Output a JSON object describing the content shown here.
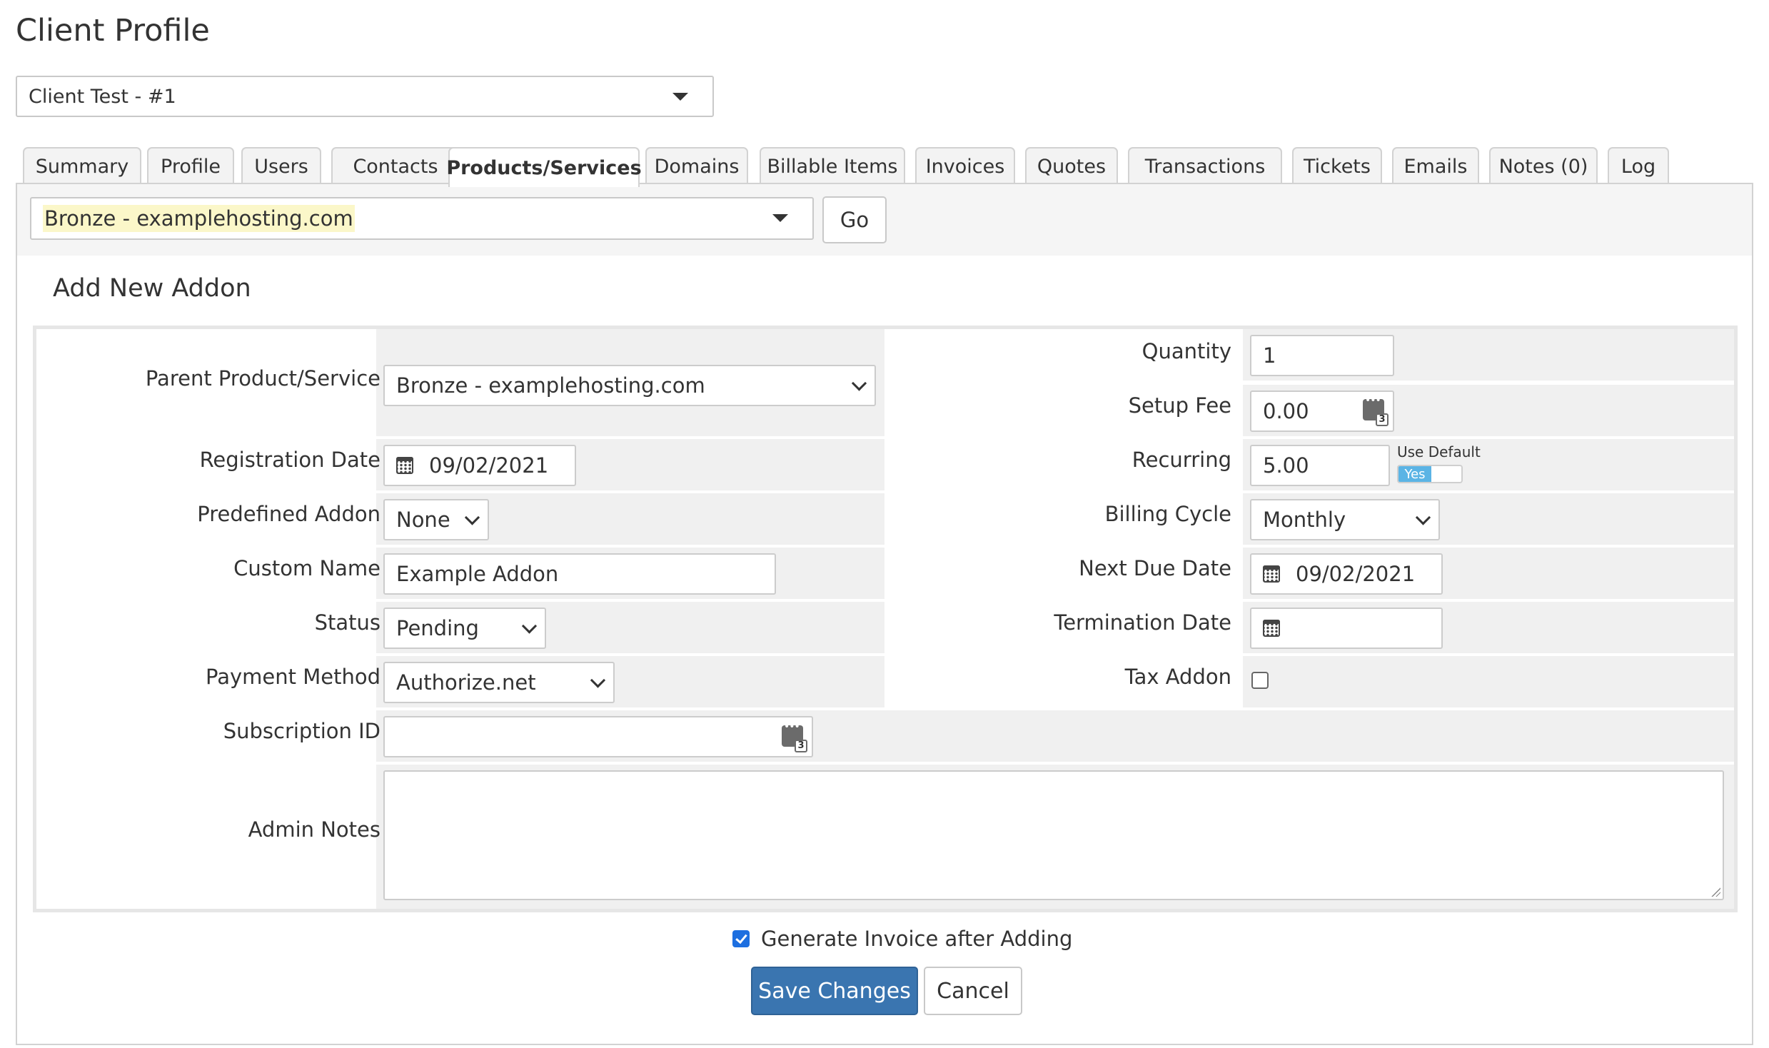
{
  "page": {
    "title": "Client Profile"
  },
  "client_selector": {
    "value": "Client Test - #1"
  },
  "tabs": [
    {
      "label": "Summary",
      "active": false
    },
    {
      "label": "Profile",
      "active": false
    },
    {
      "label": "Users",
      "active": false
    },
    {
      "label": "Contacts",
      "active": false
    },
    {
      "label": "Products/Services",
      "active": true
    },
    {
      "label": "Domains",
      "active": false
    },
    {
      "label": "Billable Items",
      "active": false
    },
    {
      "label": "Invoices",
      "active": false
    },
    {
      "label": "Quotes",
      "active": false
    },
    {
      "label": "Transactions",
      "active": false
    },
    {
      "label": "Tickets",
      "active": false
    },
    {
      "label": "Emails",
      "active": false
    },
    {
      "label": "Notes (0)",
      "active": false
    },
    {
      "label": "Log",
      "active": false
    }
  ],
  "product_bar": {
    "selected": "Bronze - examplehosting.com",
    "go_label": "Go"
  },
  "section_title": "Add New Addon",
  "form": {
    "parent_product": {
      "label": "Parent Product/Service",
      "value": "Bronze - examplehosting.com"
    },
    "registration_date": {
      "label": "Registration Date",
      "value": "09/02/2021"
    },
    "predefined_addon": {
      "label": "Predefined Addon",
      "value": "None"
    },
    "custom_name": {
      "label": "Custom Name",
      "value": "Example Addon"
    },
    "status": {
      "label": "Status",
      "value": "Pending"
    },
    "payment_method": {
      "label": "Payment Method",
      "value": "Authorize.net"
    },
    "subscription_id": {
      "label": "Subscription ID",
      "value": ""
    },
    "admin_notes": {
      "label": "Admin Notes",
      "value": ""
    },
    "quantity": {
      "label": "Quantity",
      "value": "1"
    },
    "setup_fee": {
      "label": "Setup Fee",
      "value": "0.00"
    },
    "recurring": {
      "label": "Recurring",
      "value": "5.00",
      "use_default_label": "Use Default",
      "toggle_label": "Yes"
    },
    "billing_cycle": {
      "label": "Billing Cycle",
      "value": "Monthly"
    },
    "next_due_date": {
      "label": "Next Due Date",
      "value": "09/02/2021"
    },
    "termination_date": {
      "label": "Termination Date",
      "value": ""
    },
    "tax_addon": {
      "label": "Tax Addon",
      "checked": false
    }
  },
  "footer": {
    "generate_invoice_label": "Generate Invoice after Adding",
    "generate_invoice_checked": true,
    "save_label": "Save Changes",
    "cancel_label": "Cancel"
  },
  "colors": {
    "primary_button": "#3a75b0",
    "toggle_on": "#5bb4e5",
    "highlight": "#fbf7c9"
  },
  "icons": {
    "calendar": "calendar-icon",
    "password_generator": "password-generator-icon",
    "dropdown": "chevron-down-icon"
  }
}
